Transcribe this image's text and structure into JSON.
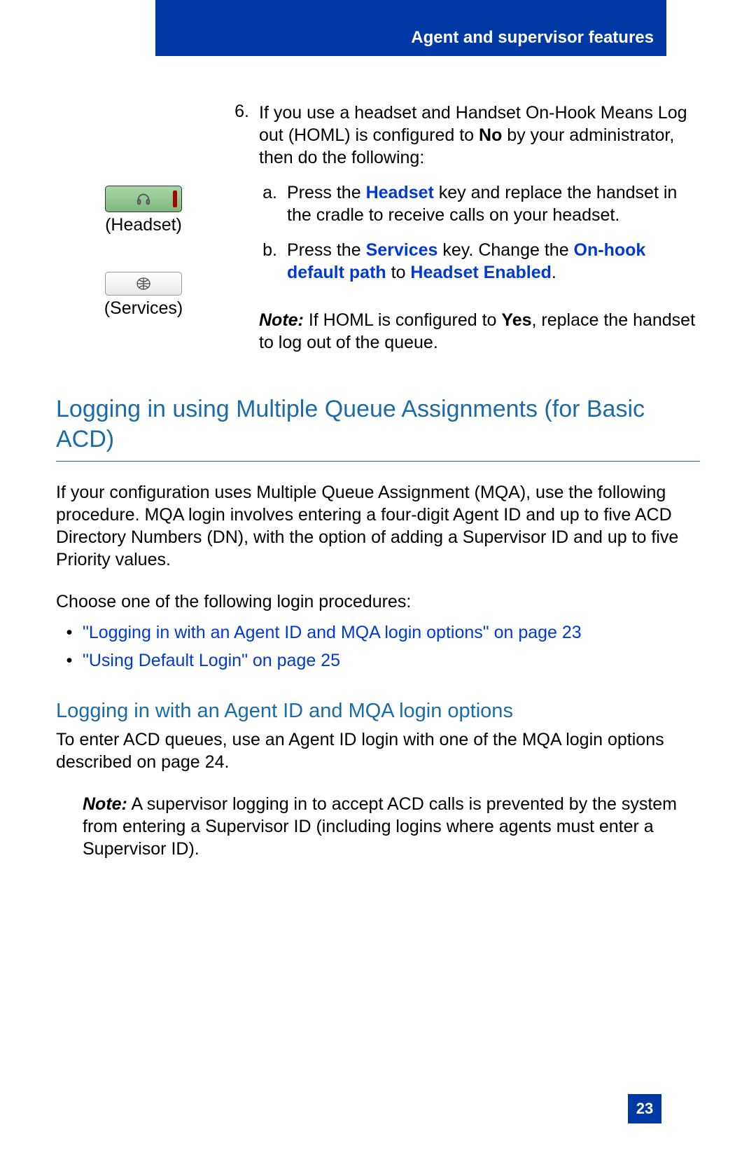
{
  "header": {
    "title": "Agent and supervisor features"
  },
  "buttons": {
    "headset_label": "(Headset)",
    "services_label": "(Services)"
  },
  "step6": {
    "number": "6.",
    "text_pre": "If you use a headset and Handset On-Hook Means Log out (HOML) is configured to ",
    "text_bold": "No",
    "text_post": " by your administrator, then do the following:",
    "sub_a": {
      "letter": "a.",
      "pre": "Press the ",
      "link": "Headset",
      "post": " key and replace the handset in the cradle to receive calls on your headset."
    },
    "sub_b": {
      "letter": "b.",
      "pre": "Press the ",
      "link1": "Services",
      "mid": " key. Change the ",
      "link2": "On-hook default path",
      "mid2": " to ",
      "link3": "Headset Enabled",
      "post": "."
    },
    "note": {
      "label": "Note:",
      "pre": " If HOML is configured to ",
      "bold": "Yes",
      "post": ", replace the handset to log out of the queue."
    }
  },
  "section": {
    "heading": "Logging in using Multiple Queue Assignments (for Basic ACD)",
    "para1": "If your configuration uses Multiple Queue Assignment (MQA), use the following procedure. MQA login involves entering a four-digit Agent ID and up to five ACD Directory Numbers (DN), with the option of adding a Supervisor ID and up to five Priority values.",
    "para2": "Choose one of the following login procedures:",
    "bullets": [
      "\"Logging in with an Agent ID and MQA login options\" on page 23",
      "\"Using Default Login\" on page 25"
    ]
  },
  "subsection": {
    "heading": "Logging in with an Agent ID and MQA login options",
    "para": "To enter ACD queues, use an Agent ID login with one of the MQA login options described on page 24.",
    "note_label": "Note:",
    "note_text": " A supervisor logging in to accept ACD calls is prevented by the system from entering a Supervisor ID (including logins where agents must enter a Supervisor ID)."
  },
  "page_number": "23"
}
